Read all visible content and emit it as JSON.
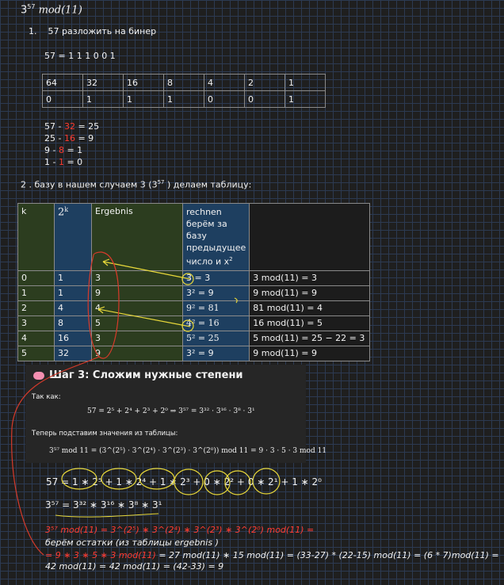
{
  "title": {
    "base": "3",
    "exp": "57",
    "mod": "mod(11)"
  },
  "step1": {
    "number": "1.",
    "text": "57 разложить на бинер"
  },
  "binary_line": "57 = 1 1 1 0 0 1",
  "bin_table": {
    "powers": [
      "64",
      "32",
      "16",
      "8",
      "4",
      "2",
      "1"
    ],
    "bits": [
      "0",
      "1",
      "1",
      "1",
      "0",
      "0",
      "1"
    ]
  },
  "subtractions": [
    {
      "a": "57 - ",
      "b": "32",
      "c": " = 25"
    },
    {
      "a": "25 - ",
      "b": "16",
      "c": " = 9"
    },
    {
      "a": "9 - ",
      "b": "8",
      "c": " = 1"
    },
    {
      "a": "1 - ",
      "b": "1",
      "c": " = 0"
    }
  ],
  "step2": {
    "pre": "2 . базу в нашем случаем 3 (3",
    "exp": "57",
    "post": " ) делаем таблицу:"
  },
  "main_table": {
    "headers": {
      "k": "k",
      "pow_base": "2",
      "pow_exp": "k",
      "ergebnis": "Ergebnis",
      "rechnen1": "rechnen",
      "rechnen2": "берём за базу",
      "rechnen3": "предыдущее",
      "rechnen4": "число и x",
      "rechnen4_exp": "2"
    },
    "rows": [
      {
        "k": "0",
        "p": "1",
        "e": "3",
        "r": "3 = 3",
        "m": "3 mod(11) = 3"
      },
      {
        "k": "1",
        "p": "1",
        "e": "9",
        "r": "3² = 9",
        "m": "9 mod(11) = 9"
      },
      {
        "k": "2",
        "p": "4",
        "e": "4",
        "r": "9² = 81",
        "m": "81 mod(11) = 4"
      },
      {
        "k": "3",
        "p": "8",
        "e": "5",
        "r": "4² = 16",
        "m": "16 mod(11) = 5"
      },
      {
        "k": "4",
        "p": "16",
        "e": "3",
        "r": "5² = 25",
        "m": "5 mod(11) = 25 − 22 = 3"
      },
      {
        "k": "5",
        "p": "32",
        "e": "9",
        "r": "3² = 9",
        "m": "9 mod(11) = 9"
      }
    ]
  },
  "panel": {
    "title": "Шаг 3: Сложим нужные степени",
    "since": "Так как:",
    "eq1": "57 = 2⁵ + 2⁴ + 2³ + 2⁰ ⇒ 3⁵⁷ = 3³² · 3¹⁶ · 3⁸ · 3¹",
    "now": "Теперь подставим значения из таблицы:",
    "eq2": "3⁵⁷   mod 11 = (3^(2⁵) · 3^(2⁴) · 3^(2³) · 3^(2⁰))   mod 11 = 9 · 3 · 5 · 3   mod 11"
  },
  "lines": {
    "l57": "57 = 1 ∗ 2⁵ + 1 ∗ 2⁴ + 1 ∗ 2³ + 0 ∗ 2² + 0 ∗ 2¹ + 1 ∗ 2⁰",
    "l57b": "3⁵⁷ = 3³² ∗ 3¹⁶ ∗ 3⁸ ∗ 3¹",
    "lmod": "3⁵⁷ mod(11) = 3^(2⁵) ∗ 3^(2⁴) ∗ 3^(2³) ∗ 3^(2⁰) mod(11) =",
    "lrest": "берём остатки (из таблицы ergebnis )",
    "lcalc_red": "= 9 ∗ 3 ∗ 5 ∗ 3 mod(11)",
    "lcalc_rest": " = 27 mod(11) ∗ 15 mod(11) = (33-27) * (22-15) mod(11) = (6 * 7)mod(11) = 42 mod(11) = 42 mod(11) = (42-33) = 9"
  },
  "colors": {
    "red": "#ff3b30",
    "yellow": "#e8d83a",
    "green_cell": "#2c3d1f",
    "blue_cell": "#1e3f60",
    "grid": "#2c3a52"
  }
}
